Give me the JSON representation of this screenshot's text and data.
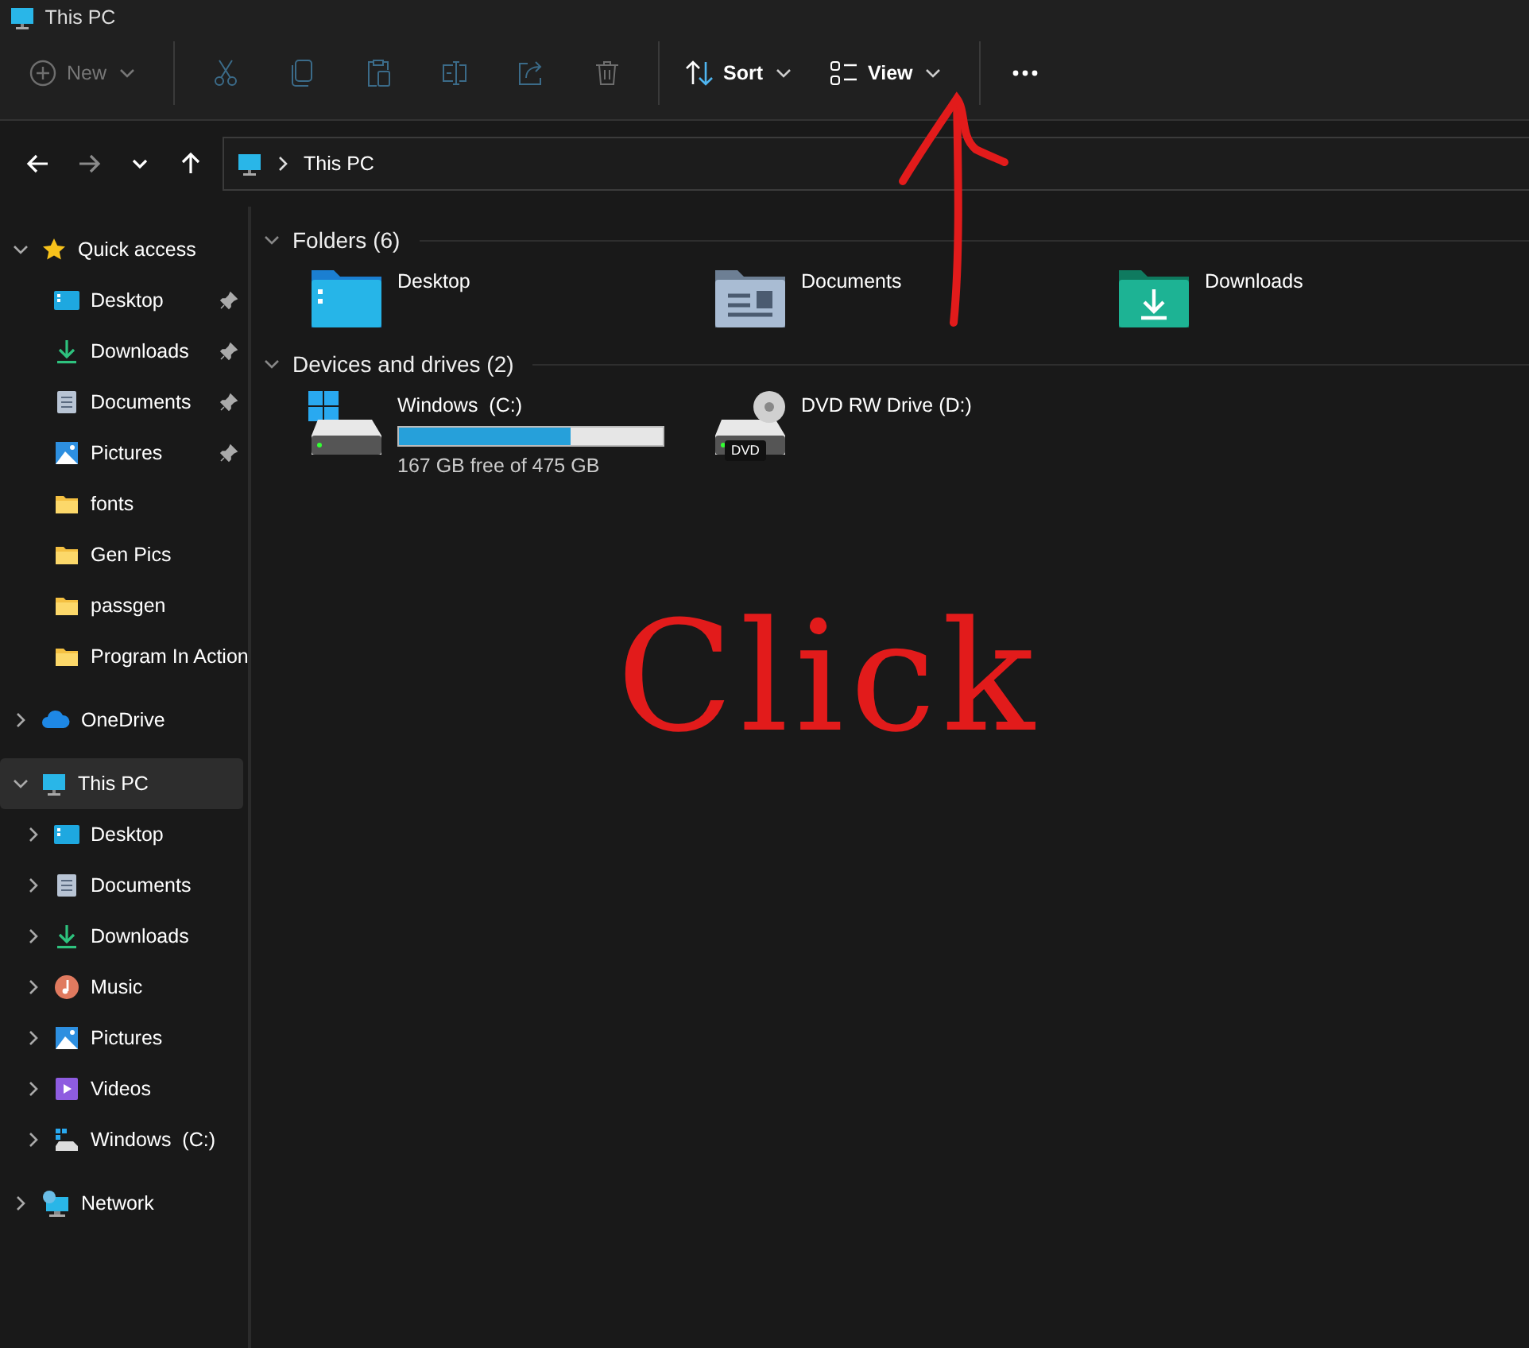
{
  "window": {
    "title": "This PC"
  },
  "toolbar": [
    {
      "kind": "new",
      "label": "New",
      "disabled": true
    },
    {
      "kind": "cut",
      "disabled": true
    },
    {
      "kind": "copy",
      "disabled": true
    },
    {
      "kind": "paste",
      "disabled": true
    },
    {
      "kind": "rename",
      "disabled": true
    },
    {
      "kind": "share",
      "disabled": true
    },
    {
      "kind": "delete",
      "disabled": true
    },
    {
      "kind": "sort",
      "label": "Sort",
      "disabled": false
    },
    {
      "kind": "view",
      "label": "View",
      "disabled": false
    },
    {
      "kind": "more",
      "disabled": false
    }
  ],
  "nav": [
    {
      "kind": "back",
      "disabled": false
    },
    {
      "kind": "forward",
      "disabled": true
    },
    {
      "kind": "recent",
      "disabled": false
    },
    {
      "kind": "up",
      "disabled": false
    }
  ],
  "address": {
    "breadcrumb": [
      "This PC"
    ]
  },
  "sidebar": {
    "items": [
      {
        "label": "Quick access",
        "kind": "star",
        "expanded": true,
        "selected": false,
        "children": [
          {
            "label": "Desktop",
            "kind": "desktop",
            "pinned": true,
            "selected": false
          },
          {
            "label": "Downloads",
            "kind": "downloads",
            "pinned": true,
            "selected": false
          },
          {
            "label": "Documents",
            "kind": "documents",
            "pinned": true,
            "selected": false
          },
          {
            "label": "Pictures",
            "kind": "pictures",
            "pinned": true,
            "selected": false
          },
          {
            "label": "fonts",
            "kind": "folder",
            "pinned": false,
            "selected": false
          },
          {
            "label": "Gen Pics",
            "kind": "folder",
            "pinned": false,
            "selected": false
          },
          {
            "label": "passgen",
            "kind": "folder",
            "pinned": false,
            "selected": false
          },
          {
            "label": "Program In Action",
            "kind": "folder",
            "pinned": false,
            "selected": false
          }
        ]
      },
      {
        "label": "OneDrive",
        "kind": "cloud",
        "expanded": false,
        "selected": false
      },
      {
        "label": "This PC",
        "kind": "pc",
        "expanded": true,
        "selected": true,
        "children": [
          {
            "label": "Desktop",
            "kind": "desktop",
            "expanded": false,
            "selected": false
          },
          {
            "label": "Documents",
            "kind": "documents",
            "expanded": false,
            "selected": false
          },
          {
            "label": "Downloads",
            "kind": "downloads",
            "expanded": false,
            "selected": false
          },
          {
            "label": "Music",
            "kind": "music",
            "expanded": false,
            "selected": false
          },
          {
            "label": "Pictures",
            "kind": "pictures",
            "expanded": false,
            "selected": false
          },
          {
            "label": "Videos",
            "kind": "videos",
            "expanded": false,
            "selected": false
          },
          {
            "label": "Windows  (C:)",
            "kind": "drive",
            "expanded": false,
            "selected": false
          }
        ]
      },
      {
        "label": "Network",
        "kind": "network",
        "expanded": false,
        "selected": false
      }
    ]
  },
  "sections": [
    {
      "title": "Folders (6)",
      "expanded": true,
      "items": [
        {
          "name": "Desktop",
          "kind": "desktop-folder"
        },
        {
          "name": "Documents",
          "kind": "documents-folder"
        },
        {
          "name": "Downloads",
          "kind": "downloads-folder"
        }
      ]
    },
    {
      "title": "Devices and drives (2)",
      "expanded": true,
      "items": [
        {
          "name": "Windows  (C:)",
          "kind": "windows-drive",
          "level": 0.65,
          "free": "167 GB free of 475 GB"
        },
        {
          "name": "DVD RW Drive (D:)",
          "kind": "dvd-drive",
          "badge": "DVD"
        }
      ]
    }
  ],
  "annotation": {
    "text": "Click"
  }
}
